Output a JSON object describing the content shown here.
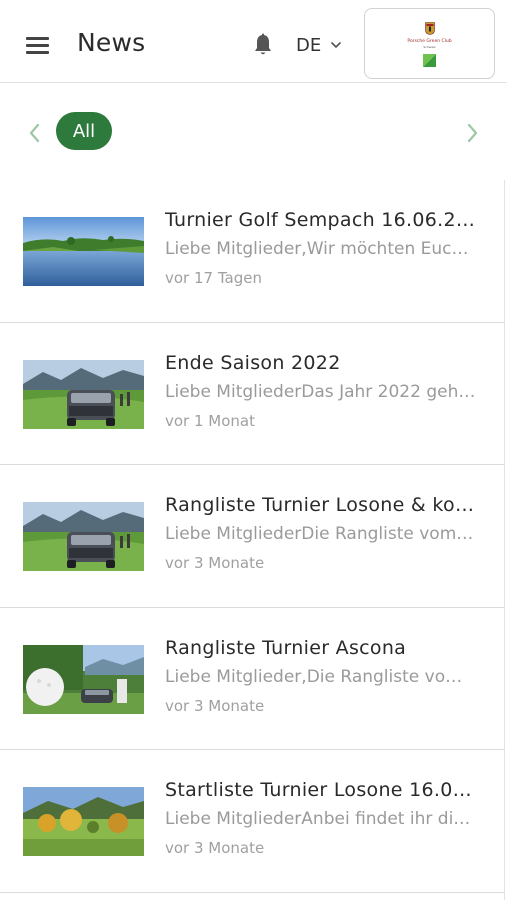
{
  "header": {
    "title": "News",
    "language": "DE",
    "logo": {
      "name": "Porsche Green Club",
      "sub": "Schweiz"
    }
  },
  "filter": {
    "active_chip": "All"
  },
  "news": [
    {
      "title": "Turnier Golf Sempach 16.06.2…",
      "excerpt": "Liebe Mitglieder,Wir möchten Euch…",
      "time": "vor 17 Tagen",
      "image": "golf-lake"
    },
    {
      "title": "Ende Saison 2022",
      "excerpt": "Liebe MitgliederDas Jahr 2022 geh…",
      "time": "vor 1 Monat",
      "image": "car-on-fairway"
    },
    {
      "title": "Rangliste Turnier Losone & ko…",
      "excerpt": "Liebe MitgliederDie Rangliste vom …",
      "time": "vor 3 Monate",
      "image": "car-on-fairway"
    },
    {
      "title": "Rangliste Turnier Ascona",
      "excerpt": "Liebe Mitglieder,Die Rangliste vom…",
      "time": "vor 3 Monate",
      "image": "golfball-display"
    },
    {
      "title": "Startliste Turnier Losone 16.0…",
      "excerpt": "Liebe MitgliederAnbei findet ihr di…",
      "time": "vor 3 Monate",
      "image": "autumn-course"
    }
  ],
  "colors": {
    "accent": "#2d7a3c",
    "text_primary": "#2a2a2a",
    "text_secondary": "#9a9a9a",
    "chevron": "#9cc7a3"
  },
  "icons": [
    "menu-icon",
    "bell-icon",
    "chevron-down-icon",
    "chevron-left-icon",
    "chevron-right-icon"
  ]
}
